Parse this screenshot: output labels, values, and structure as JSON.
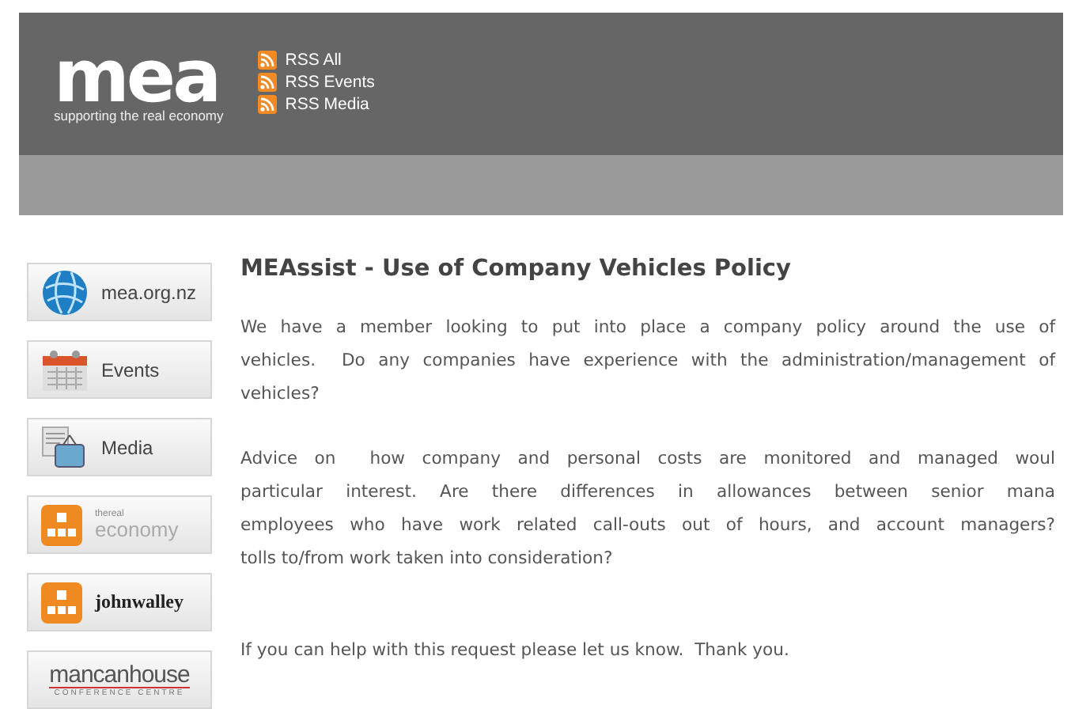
{
  "header": {
    "logo": {
      "wordmark": "mea",
      "tagline": "supporting the real economy"
    },
    "rss_links": [
      "RSS All",
      "RSS Events",
      "RSS Media"
    ]
  },
  "sidebar": {
    "items": [
      {
        "kind": "globe",
        "label": "mea.org.nz"
      },
      {
        "kind": "calendar",
        "label": "Events"
      },
      {
        "kind": "media",
        "label": "Media"
      },
      {
        "kind": "economy",
        "small": "thereal",
        "label": "economy"
      },
      {
        "kind": "johnwalley",
        "label": "johnwalley"
      },
      {
        "kind": "mancan",
        "label": "mancanhouse",
        "small": "CONFERENCE CENTRE"
      }
    ]
  },
  "article": {
    "title": "MEAssist - Use of Company Vehicles Policy",
    "paragraphs": [
      [
        "We have a member looking to put into place a company policy around the use of",
        "vehicles.  Do any companies have experience with the administration/management of",
        "vehicles?"
      ],
      [
        "Advice on  how company and personal costs are monitored and managed woul",
        "particular interest. Are there differences in allowances between senior mana",
        "employees who have work related call-outs out of hours, and account managers?",
        "tolls to/from work taken into consideration?"
      ],
      [
        "If you can help with this request please let us know.  Thank you."
      ]
    ]
  }
}
